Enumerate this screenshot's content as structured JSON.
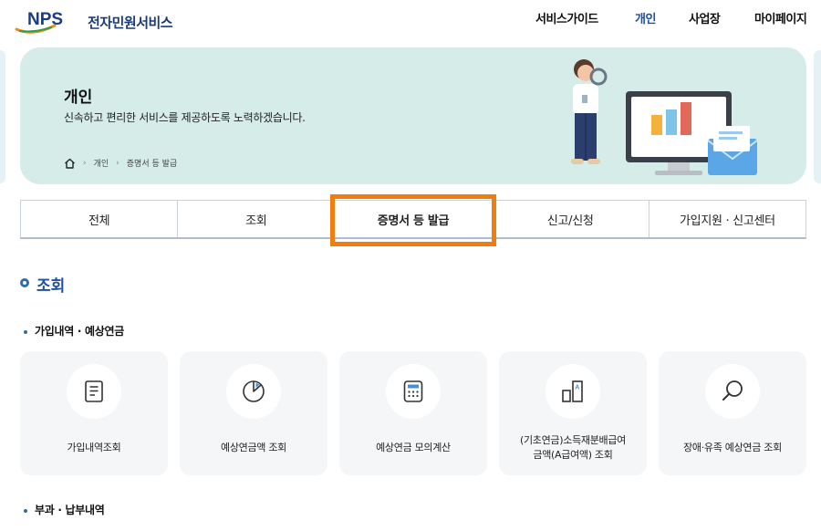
{
  "header": {
    "logo_text": "NPS",
    "service_name": "전자민원서비스",
    "nav": [
      "서비스가이드",
      "개인",
      "사업장",
      "마이페이지"
    ],
    "active_nav": "개인"
  },
  "hero": {
    "title": "개인",
    "subtitle": "신속하고 편리한 서비스를 제공하도록 노력하겠습니다.",
    "breadcrumb": [
      "개인",
      "증명서 등 발급"
    ],
    "home_icon": "home-icon"
  },
  "tabs": [
    "전체",
    "조회",
    "증명서 등 발급",
    "신고/신청",
    "가입지원 · 신고센터"
  ],
  "selected_tab": "증명서 등 발급",
  "section": {
    "title": "조회",
    "groups": [
      {
        "title": "가입내역 · 예상연금",
        "cards": [
          {
            "label": "가입내역조회",
            "icon": "document-icon"
          },
          {
            "label": "예상연금액 조회",
            "icon": "pie-chart-icon"
          },
          {
            "label": "예상연금 모의계산",
            "icon": "calculator-icon"
          },
          {
            "label": "(기초연금)소득재분배급여\n금액(A급여액) 조회",
            "icon": "bar-compare-icon"
          },
          {
            "label": "장애·유족 예상연금 조회",
            "icon": "magnifier-icon"
          }
        ]
      },
      {
        "title": "부과 · 납부내역"
      }
    ]
  },
  "colors": {
    "brand_blue": "#1f4fa3",
    "hero_bg": "#d5ece9",
    "highlight": "#f07d0d",
    "card_bg": "#f5f6f7"
  }
}
